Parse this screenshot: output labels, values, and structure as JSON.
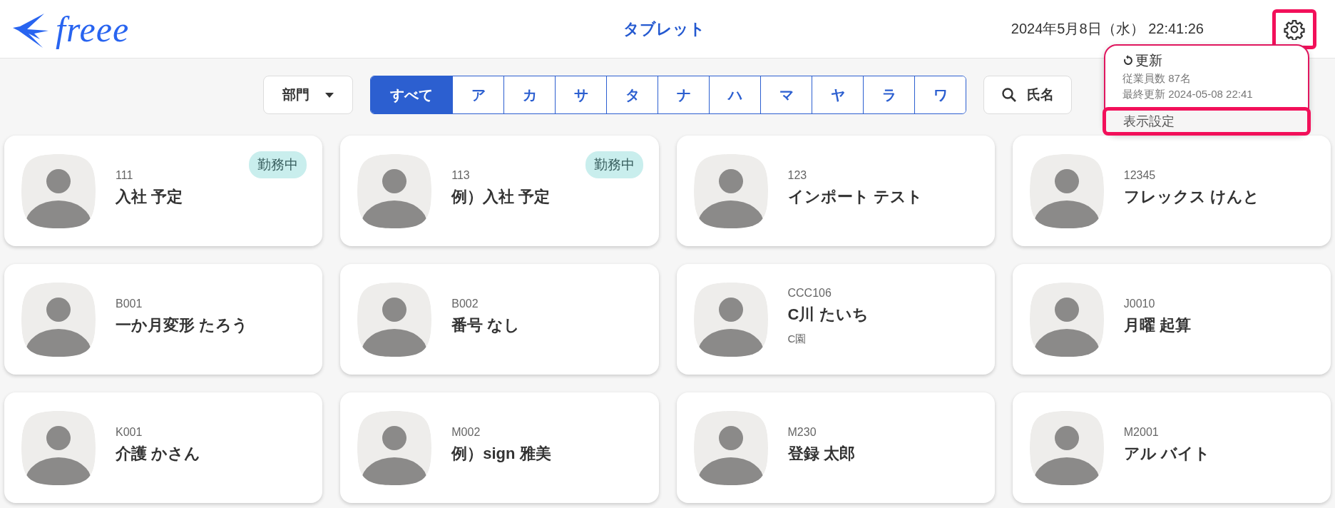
{
  "header": {
    "logo_text": "freee",
    "title": "タブレット",
    "datetime": "2024年5月8日（水） 22:41:26",
    "settings_button": {
      "highlighted": true
    }
  },
  "settings_menu": {
    "refresh_label": "更新",
    "employee_count": "従業員数 87名",
    "last_updated": "最終更新 2024-05-08 22:41",
    "items": [
      {
        "label": "表示設定",
        "highlighted": true
      }
    ]
  },
  "filters": {
    "department": "部門",
    "kana_tabs": [
      {
        "label": "すべて",
        "selected": true
      },
      {
        "label": "ア",
        "selected": false
      },
      {
        "label": "カ",
        "selected": false
      },
      {
        "label": "サ",
        "selected": false
      },
      {
        "label": "タ",
        "selected": false
      },
      {
        "label": "ナ",
        "selected": false
      },
      {
        "label": "ハ",
        "selected": false
      },
      {
        "label": "マ",
        "selected": false
      },
      {
        "label": "ヤ",
        "selected": false
      },
      {
        "label": "ラ",
        "selected": false
      },
      {
        "label": "ワ",
        "selected": false
      }
    ],
    "name_search": "氏名"
  },
  "employees": [
    {
      "code": "111",
      "name": "入社 予定",
      "badge": "勤務中"
    },
    {
      "code": "113",
      "name": "例）入社 予定",
      "badge": "勤務中"
    },
    {
      "code": "123",
      "name": "インポート テスト"
    },
    {
      "code": "12345",
      "name": "フレックス けんと"
    },
    {
      "code": "B001",
      "name": "一か月変形 たろう"
    },
    {
      "code": "B002",
      "name": "番号 なし"
    },
    {
      "code": "CCC106",
      "name": "C川 たいち",
      "department": "C園"
    },
    {
      "code": "J0010",
      "name": "月曜 起算"
    },
    {
      "code": "K001",
      "name": "介護 かさん"
    },
    {
      "code": "M002",
      "name": "例）sign 雅美"
    },
    {
      "code": "M230",
      "name": "登録 太郎"
    },
    {
      "code": "M2001",
      "name": "アル バイト"
    }
  ]
}
